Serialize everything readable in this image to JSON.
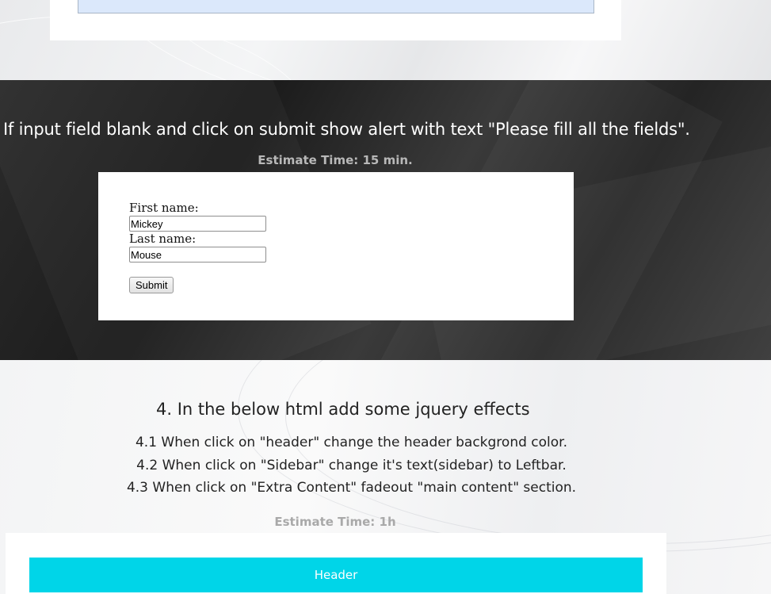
{
  "task3": {
    "instruction": "If input field blank and click on submit show alert with text \"Please fill all the fields\".",
    "estimate": "Estimate Time: 15 min.",
    "form": {
      "first_name_label": "First name:",
      "first_name_value": "Mickey",
      "last_name_label": "Last name:",
      "last_name_value": "Mouse",
      "submit_label": "Submit"
    }
  },
  "task4": {
    "heading": "4. In the below html add some jquery effects",
    "items": [
      "4.1 When click on \"header\" change the header backgrond color.",
      "4.2 When click on \"Sidebar\" change it's text(sidebar) to Leftbar.",
      "4.3 When click on \"Extra Content\" fadeout \"main content\" section."
    ],
    "estimate": "Estimate Time: 1h",
    "demo_header_label": "Header"
  },
  "colors": {
    "dark_bg": "#242424",
    "demo_header_bg": "#00d5e8",
    "textarea_bg": "#dbe8fb"
  }
}
